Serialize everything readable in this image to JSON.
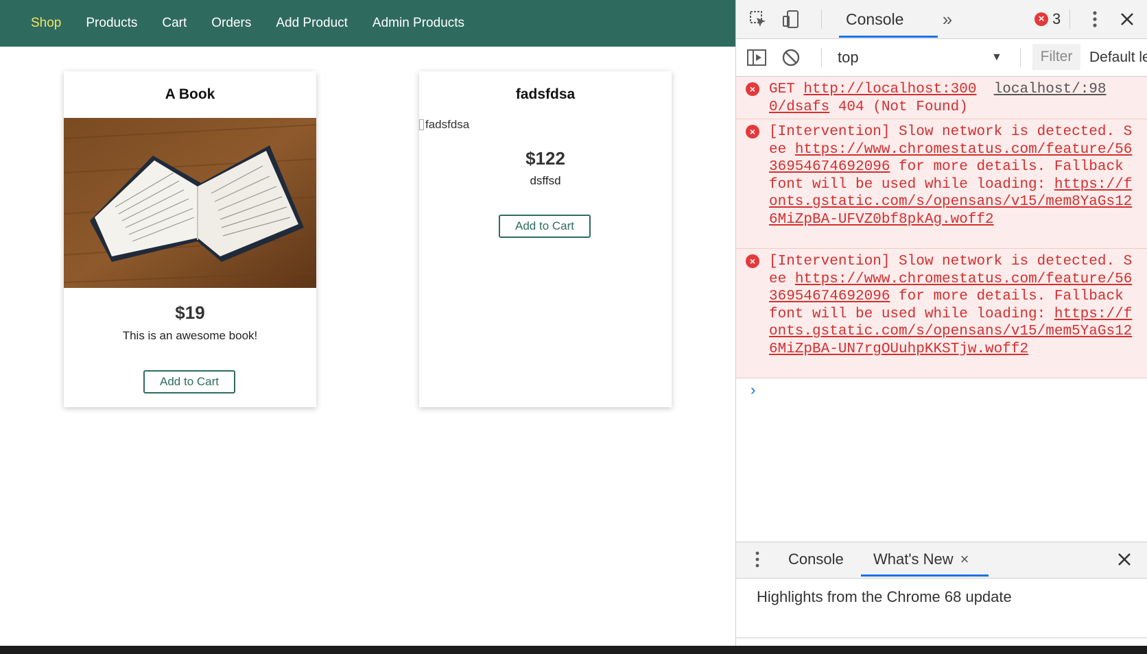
{
  "shop": {
    "nav": {
      "items": [
        "Shop",
        "Products",
        "Cart",
        "Orders",
        "Add Product",
        "Admin Products"
      ],
      "active_index": 0
    },
    "products": [
      {
        "title": "A Book",
        "price": "$19",
        "description": "This is an awesome book!",
        "image": "open book photo",
        "button": "Add to Cart"
      },
      {
        "title": "fadsfdsa",
        "price": "$122",
        "description": "dsffsd",
        "image_alt": "fadsfdsa",
        "button": "Add to Cart"
      }
    ],
    "colors": {
      "header": "#2f6a5f",
      "active_nav": "#f2e36b"
    }
  },
  "devtools": {
    "toolbar": {
      "inspect_icon": "inspect-element-icon",
      "device_icon": "device-toolbar-icon",
      "tab": "Console",
      "more_tabs": "»",
      "error_count": "3",
      "menu_icon": "kebab-menu-icon",
      "close_icon": "close-icon"
    },
    "filterbar": {
      "sidebar_icon": "console-sidebar-icon",
      "clear_icon": "clear-console-icon",
      "context": "top",
      "filter_placeholder": "Filter",
      "levels": "Default levels"
    },
    "messages": [
      {
        "type": "error",
        "text": "GET http://localhost:3000/dsafs 404 (Not Found)",
        "url": "http://localhost:300 0/dsafs",
        "source": "localhost/:98"
      },
      {
        "type": "error",
        "text": "[Intervention] Slow network is detected. See https://www.chromestatus.com/feature/5636954674692096 for more details. Fallback font will be used while loading: https://fonts.gstatic.com/s/opensans/v15/mem8YaGs126MiZpBA-UFVZ0bf8pkAg.woff2"
      },
      {
        "type": "error",
        "text": "[Intervention] Slow network is detected. See https://www.chromestatus.com/feature/5636954674692096 for more details. Fallback font will be used while loading: https://fonts.gstatic.com/s/opensans/v15/mem5YaGs126MiZpBA-UN7rgOUuhpKKSTjw.woff2"
      }
    ],
    "prompt": "›",
    "drawer": {
      "tabs": [
        "Console",
        "What's New"
      ],
      "active_index": 1,
      "close_tab_glyph": "×",
      "close_glyph": "✕",
      "highlights": "Highlights from the Chrome 68 update"
    }
  }
}
